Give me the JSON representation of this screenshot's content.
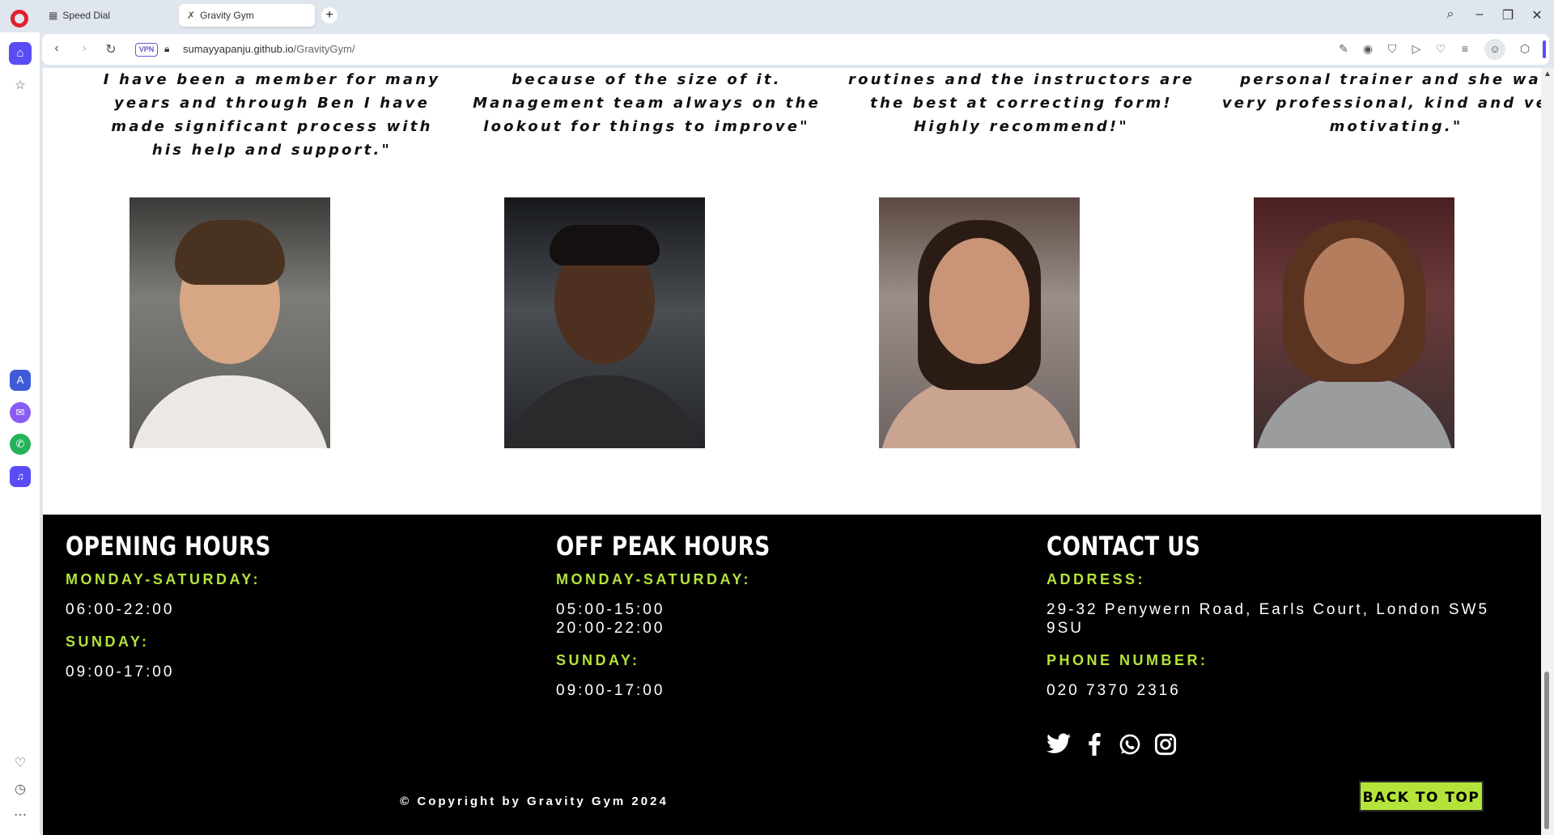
{
  "browser": {
    "tabs": [
      {
        "label": "Speed Dial",
        "icon": "speed-dial-icon",
        "active": false
      },
      {
        "label": "Gravity Gym",
        "icon": "dumbbell-icon",
        "active": true
      }
    ],
    "new_tab_label": "+",
    "vpn_label": "VPN",
    "url_domain": "sumayyapanju.github.io",
    "url_path": "/GravityGym/"
  },
  "reviews": [
    {
      "quote": "I have been a member for many years and through Ben I have made significant process with his help and support.\""
    },
    {
      "quote": "because of the size of it. Management team always on the lookout for things to improve\""
    },
    {
      "quote": "routines and the instructors are the best at correcting form! Highly recommend!\""
    },
    {
      "quote": "personal trainer and she was very professional, kind and very motivating.\""
    }
  ],
  "footer": {
    "opening": {
      "title": "OPENING HOURS",
      "weekday_label": "MONDAY-SATURDAY:",
      "weekday_hours": "06:00-22:00",
      "sunday_label": "SUNDAY:",
      "sunday_hours": "09:00-17:00"
    },
    "offpeak": {
      "title": "OFF PEAK HOURS",
      "weekday_label": "MONDAY-SATURDAY:",
      "weekday_hours_1": "05:00-15:00",
      "weekday_hours_2": "20:00-22:00",
      "sunday_label": "SUNDAY:",
      "sunday_hours": "09:00-17:00"
    },
    "contact": {
      "title": "CONTACT US",
      "address_label": "ADDRESS:",
      "address": "29-32 Penywern Road, Earls Court, London SW5 9SU",
      "phone_label": "PHONE NUMBER:",
      "phone": "020 7370 2316"
    },
    "social_icons": [
      "twitter-icon",
      "facebook-icon",
      "whatsapp-icon",
      "instagram-icon"
    ],
    "copyright": "© Copyright by Gravity Gym 2024",
    "back_to_top": "BACK TO TOP"
  },
  "colors": {
    "accent": "#b4e43a",
    "footer_bg": "#000000",
    "opera_sidebar_active": "#5a4cf5"
  }
}
